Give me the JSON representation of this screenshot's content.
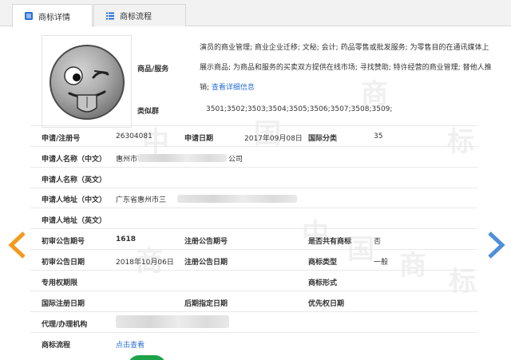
{
  "tabs": [
    {
      "label": "商标详情",
      "icon": "document-icon"
    },
    {
      "label": "商标流程",
      "icon": "list-icon"
    }
  ],
  "watermark": {
    "chars": [
      "中",
      "国",
      "商",
      "标"
    ]
  },
  "logo": {
    "description_icon": "winking-tongue-emoji"
  },
  "services": {
    "label": "商品/服务",
    "text": "演员的商业管理; 商业企业迁移; 文秘; 会计; 药品零售或批发服务; 为零售目的在通讯媒体上展示商品; 为商品和服务的买卖双方提供在线市场; 寻找赞助; 特许经营的商业管理; 替他人推销;",
    "link": "查看详细信息"
  },
  "similar_group": {
    "label": "类似群",
    "value": "3501;3502;3503;3504;3505;3506;3507;3508;3509;"
  },
  "fields": {
    "reg_no": {
      "label": "申请/注册号",
      "value": "26304081"
    },
    "apply_date": {
      "label": "申请日期",
      "value": "2017年09月08日"
    },
    "intl_class": {
      "label": "国际分类",
      "value": "35"
    },
    "applicant_cn": {
      "label": "申请人名称（中文）",
      "value_prefix": "惠州市",
      "value_suffix": "公司"
    },
    "applicant_en": {
      "label": "申请人名称（英文）",
      "value": ""
    },
    "address_cn": {
      "label": "申请人地址（中文）",
      "value_prefix": "广东省惠州市三"
    },
    "address_en": {
      "label": "申请人地址（英文）",
      "value": ""
    },
    "prelim_no": {
      "label": "初审公告期号",
      "value": "1618"
    },
    "reg_pub_no": {
      "label": "注册公告期号",
      "value": ""
    },
    "shared": {
      "label": "是否共有商标",
      "value": "否"
    },
    "prelim_date": {
      "label": "初审公告日期",
      "value": "2018年10月06日"
    },
    "reg_pub_date": {
      "label": "注册公告日期",
      "value": ""
    },
    "mark_type": {
      "label": "商标类型",
      "value": "一般"
    },
    "exclusive_period": {
      "label": "专用权期限",
      "value": ""
    },
    "mark_form": {
      "label": "商标形式",
      "value": ""
    },
    "intl_reg_date": {
      "label": "国际注册日期",
      "value": ""
    },
    "later_date": {
      "label": "后期指定日期",
      "value": ""
    },
    "priority_date": {
      "label": "优先权日期",
      "value": ""
    },
    "agent": {
      "label": "代理/办理机构",
      "value": ""
    },
    "process": {
      "label": "商标流程",
      "link": "点击查看"
    }
  },
  "colors": {
    "link": "#2a6fd6",
    "arrow_left": "#f39a1c",
    "arrow_right": "#4f8fd9",
    "leaf": "#1ea24a"
  }
}
